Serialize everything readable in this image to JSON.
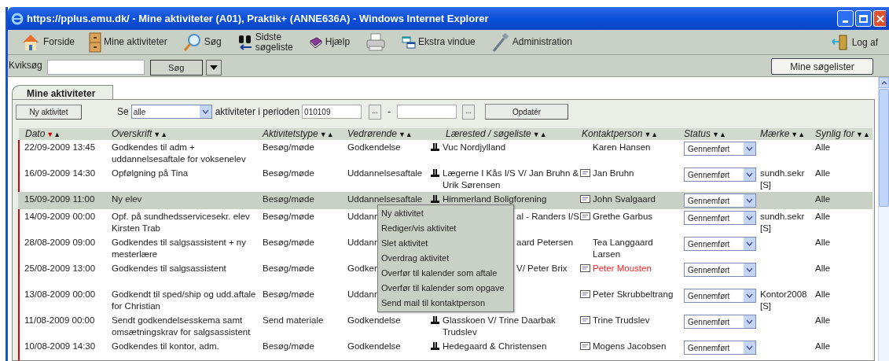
{
  "window": {
    "title": "https://pplus.emu.dk/ - Mine aktiviteter (A01), Praktik+ (ANNE636A) - Windows Internet Explorer"
  },
  "toolbar": [
    {
      "label": "Forside",
      "kind": "home"
    },
    {
      "label": "Mine aktiviteter",
      "kind": "cabinet"
    },
    {
      "label": "Søg",
      "kind": "search"
    },
    {
      "label": "Sidste søgeliste",
      "kind": "binoculars"
    },
    {
      "label": "Hjælp",
      "kind": "help"
    },
    {
      "kind": "printer"
    },
    {
      "label": "Ekstra vindue",
      "kind": "window"
    },
    {
      "label": "Administration",
      "kind": "wrench"
    }
  ],
  "logoff": {
    "label": "Log af"
  },
  "quicksearch": {
    "label": "Kviksøg",
    "button": "Søg",
    "saved_lists_button": "Mine søgelister"
  },
  "tab": {
    "label": "Mine aktiviteter",
    "selected": true
  },
  "filter": {
    "new_button": "Ny aktivitet",
    "se_label": "Se",
    "se_value": "alle",
    "period_label": "aktiviteter i perioden",
    "from": "010109",
    "picker": "...",
    "dash": "-",
    "picker2": "...",
    "update_button": "Opdatér"
  },
  "table": {
    "columns": [
      {
        "label": "Dato",
        "sort_down": "▼",
        "sort_up": "▲",
        "sort_desc_active": true
      },
      {
        "label": "Overskrift",
        "sort_down": "▼",
        "sort_up": "▲",
        "sort_desc_active": false
      },
      {
        "label": "Aktivitetstype",
        "sort_down": "▼",
        "sort_up": "▲",
        "sort_desc_active": false
      },
      {
        "label": "Vedrørende",
        "sort_down": "▼",
        "sort_up": "▲",
        "sort_desc_active": false
      },
      {
        "label": "Lærested / søgeliste",
        "sort_down": "▼",
        "sort_up": "▲",
        "sort_desc_active": false
      },
      {
        "label": "Kontaktperson",
        "sort_down": "▼",
        "sort_up": "▲",
        "sort_desc_active": false
      },
      {
        "label": "Status",
        "sort_down": "▼",
        "sort_up": "▲",
        "sort_desc_active": false
      },
      {
        "label": "Mærke",
        "sort_down": "▼",
        "sort_up": "▲",
        "sort_desc_active": false
      },
      {
        "label": "Synlig for",
        "sort_down": "▼",
        "sort_up": "▲",
        "sort_desc_active": false
      }
    ],
    "rows": [
      {
        "selected": false,
        "date": "22/09-2009 13:45",
        "title": "Godkendes til adm + uddannelsesaftale for voksenelev",
        "type": "Besøg/møde",
        "regarding": "Godkendelse",
        "place_icon": true,
        "place": "Vuc Nordjylland",
        "contact_icon": false,
        "contact": "Karen Hansen",
        "contact_highlighted": false,
        "status": "Gennemført",
        "visible": "Alle"
      },
      {
        "selected": false,
        "date": "16/09-2009 14:30",
        "title": "Opfølgning på Tina",
        "type": "Besøg/møde",
        "regarding": "Uddannelsesaftale",
        "place_icon": true,
        "place": "Lægerne I Kås I/S V/ Jan Bruhn & Urik Sørensen",
        "contact_icon": true,
        "contact": "Jan Bruhn",
        "contact_highlighted": false,
        "status": "Gennemført",
        "tag": "sundh.sekr [S]",
        "visible": "Alle"
      },
      {
        "selected": true,
        "date": "15/09-2009 11:00",
        "title": "Ny elev",
        "type": "Besøg/møde",
        "regarding": "Uddannelsesaftale",
        "place_icon": true,
        "place": "Himmerland Boligforening",
        "contact_icon": true,
        "contact": "John Svalgaard",
        "contact_highlighted": false,
        "status": "Gennemført",
        "visible": "Alle"
      },
      {
        "selected": false,
        "date": "14/09-2009 00:00",
        "title": "Opf. på sundhedsservicesekr. elev Kirsten Trab",
        "type": "Besøg/møde",
        "regarding": "Uddann",
        "place_icon": false,
        "place": "al - Randers I/S",
        "contact_icon": true,
        "contact": "Grethe Garbus",
        "contact_highlighted": false,
        "status": "Gennemført",
        "tag": "sundh.sekr [S]",
        "visible": "Alle"
      },
      {
        "selected": false,
        "date": "28/08-2009 09:00",
        "title": "Godkendes til salgsassistent + ny mesterlære",
        "type": "Besøg/møde",
        "regarding": "Uddann",
        "place_icon": false,
        "place": "aard Petersen",
        "contact_icon": false,
        "contact": "Tea Langgaard Larsen",
        "contact_highlighted": false,
        "status": "Gennemført",
        "visible": "Alle"
      },
      {
        "selected": false,
        "date": "25/08-2009 13:00",
        "title": "Godkendes til salgsassistent",
        "type": "Besøg/møde",
        "regarding": "Godken",
        "place_icon": false,
        "place": "V/ Peter Brix",
        "contact_icon": true,
        "contact": "Peter Mousten",
        "contact_highlighted": true,
        "status": "Gennemført",
        "visible": "Alle"
      },
      {
        "selected": false,
        "date": "13/08-2009 00:00",
        "title": "Godkendt til sped/ship og udd.aftale for Christian",
        "type": "Besøg/møde",
        "regarding": "Uddann",
        "place_icon": false,
        "contact_icon": true,
        "contact": "Peter Skrubbeltrang",
        "contact_highlighted": false,
        "status": "Gennemført",
        "tag": "Kontor2008 [S]",
        "visible": "Alle"
      },
      {
        "selected": false,
        "date": "11/08-2009 00:00",
        "title": "Sendt godkendelsesskema samt omsætningskrav for salgsassistent",
        "type": "Send materiale",
        "regarding": "Godkendelse",
        "place_icon": true,
        "place": "Glasskoen V/ Trine Daarbak Trudslev",
        "contact_icon": true,
        "contact": "Trine Trudslev",
        "contact_highlighted": false,
        "status": "Gennemført",
        "visible": "Alle"
      },
      {
        "selected": false,
        "date": "10/08-2009 14:30",
        "title": "Godkendes til kontor, adm.",
        "type": "Besøg/møde",
        "regarding": "Godkendelse",
        "place_icon": true,
        "place": "Hedegaard & Christensen",
        "contact_icon": true,
        "contact": "Mogens Jacobsen",
        "contact_highlighted": false,
        "status": "Gennemført",
        "visible": "Alle"
      }
    ]
  },
  "context_menu": [
    "Ny aktivitet",
    "Rediger/vis aktivitet",
    "Slet aktivitet",
    "Overdrag aktivitet",
    "Overfør til kalender som aftale",
    "Overfør til kalender som opgave",
    "Send mail til kontaktperson"
  ]
}
